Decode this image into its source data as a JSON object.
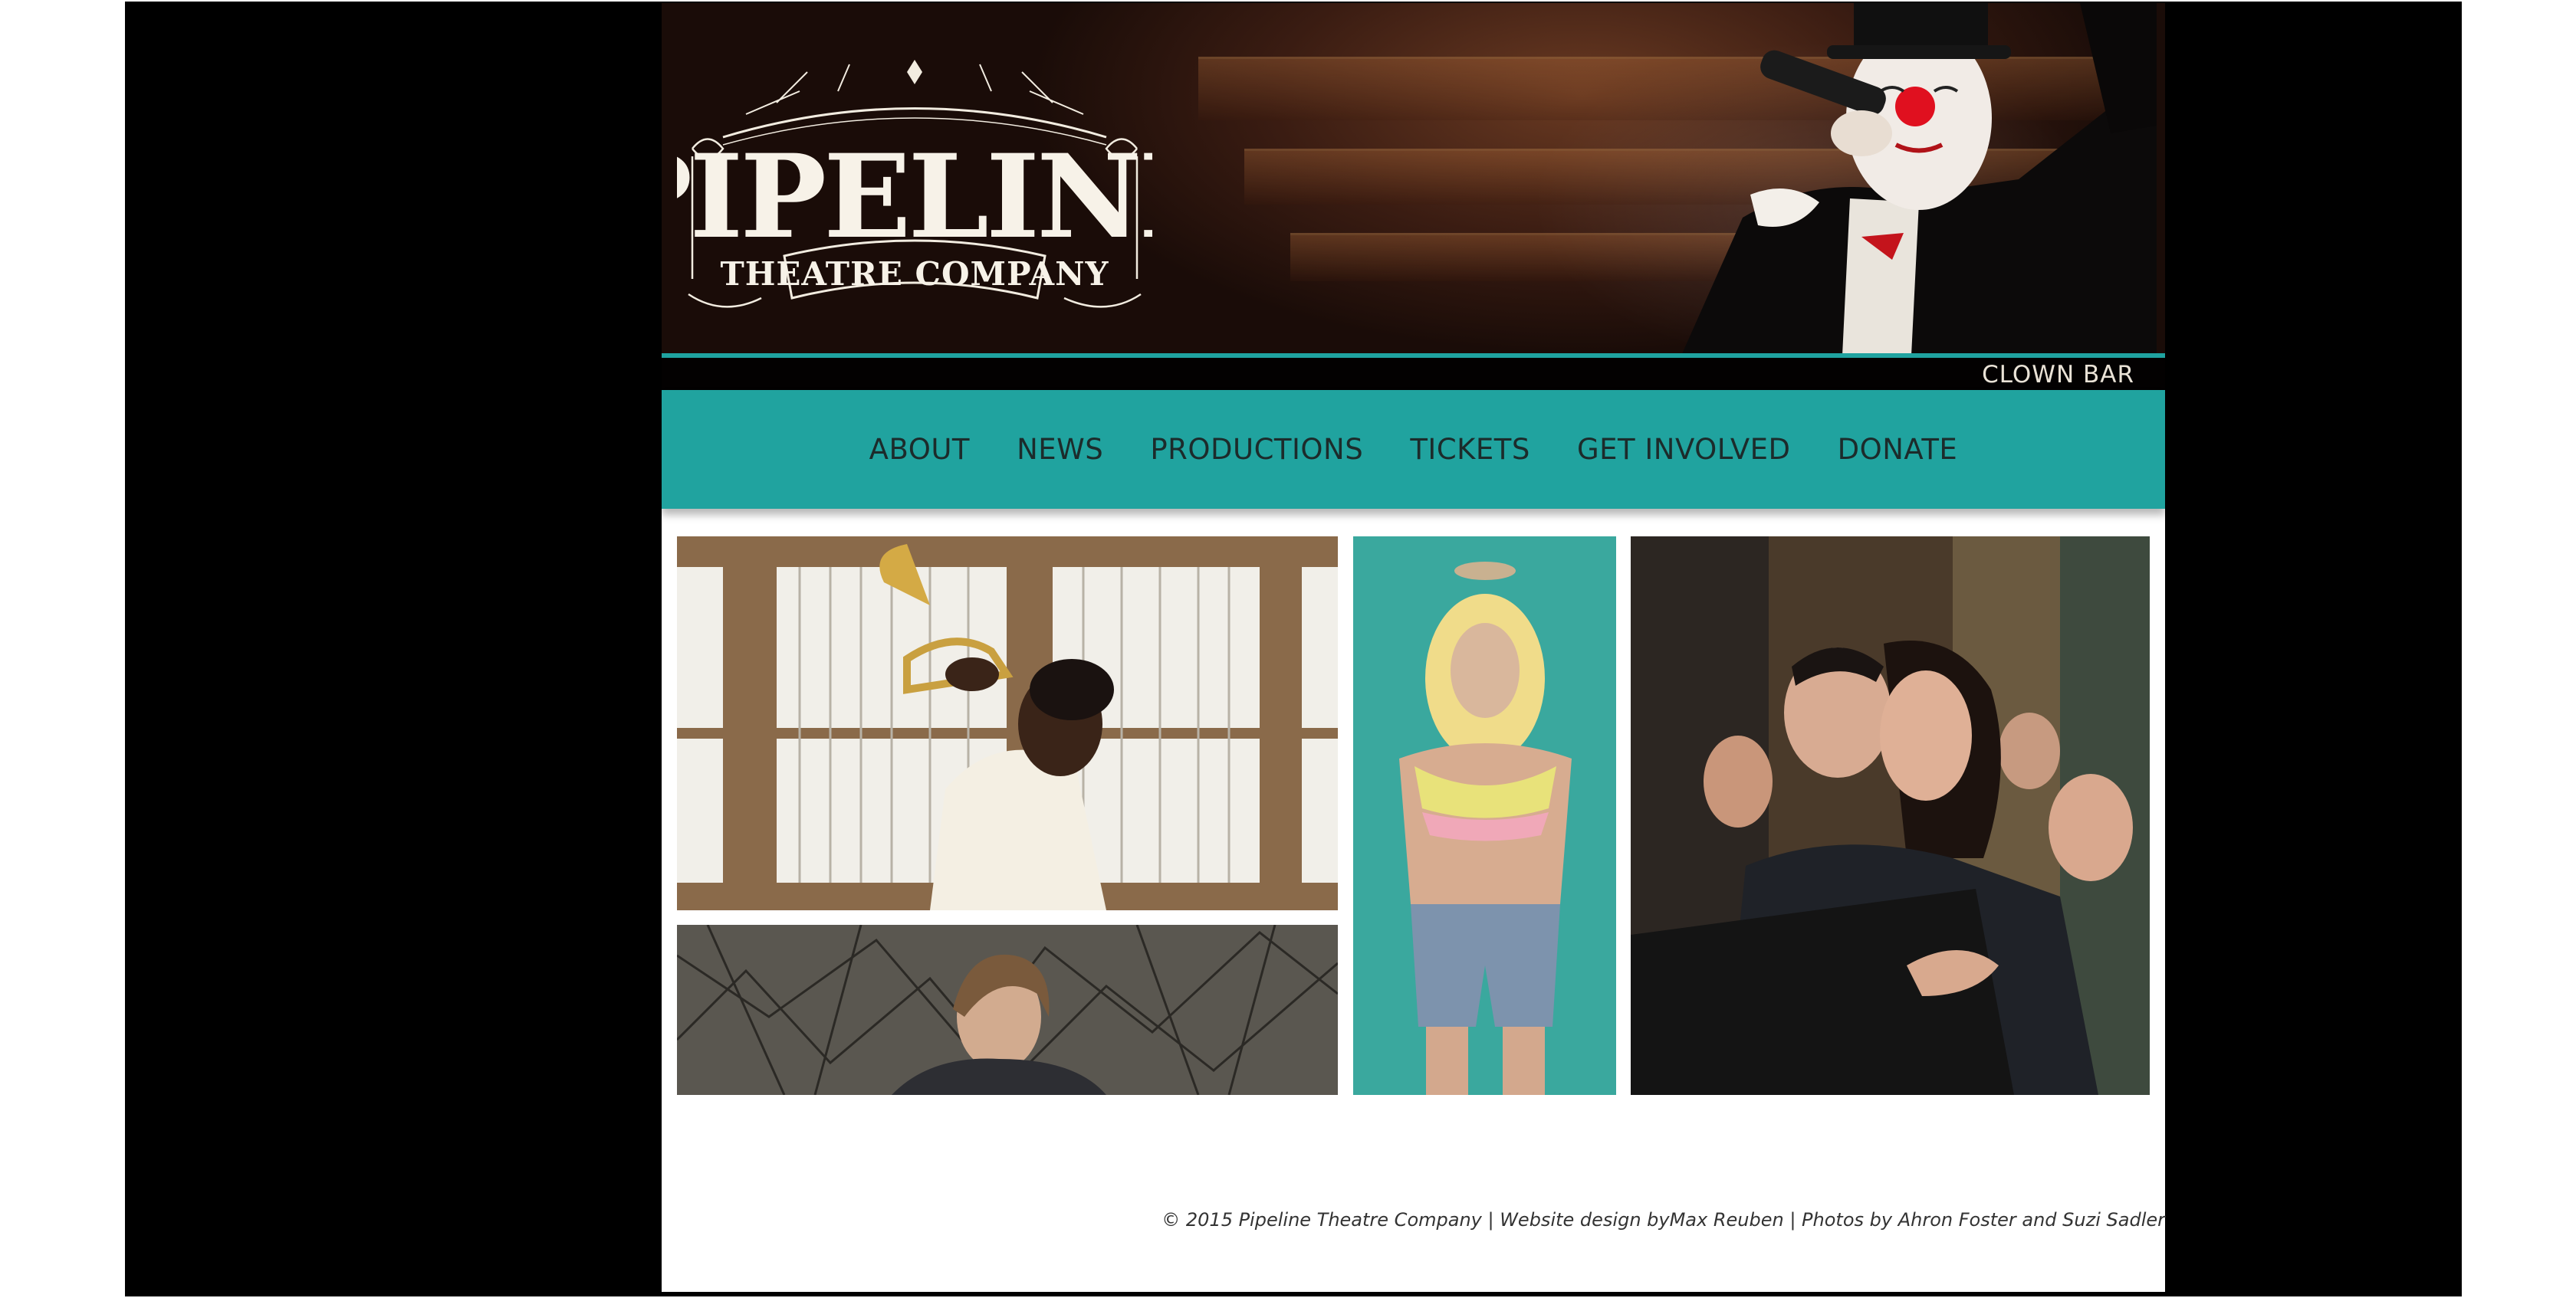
{
  "header": {
    "logo": {
      "name": "PIPELINE",
      "tagline": "THEATRE COMPANY"
    },
    "caption": "CLOWN BAR"
  },
  "nav": {
    "items": [
      {
        "label": "ABOUT"
      },
      {
        "label": "NEWS"
      },
      {
        "label": "PRODUCTIONS"
      },
      {
        "label": "TICKETS"
      },
      {
        "label": "GET INVOLVED"
      },
      {
        "label": "DONATE"
      }
    ]
  },
  "footer": {
    "copyright": "© 2015 Pipeline Theatre Company | Website design by",
    "designer": "Max Reuben",
    "photos_credit": " | Photos by Ahron Foster and Suzi Sadler"
  },
  "colors": {
    "teal": "#20a39f",
    "header_dark": "#1a0c08",
    "page_bg": "#000000"
  }
}
